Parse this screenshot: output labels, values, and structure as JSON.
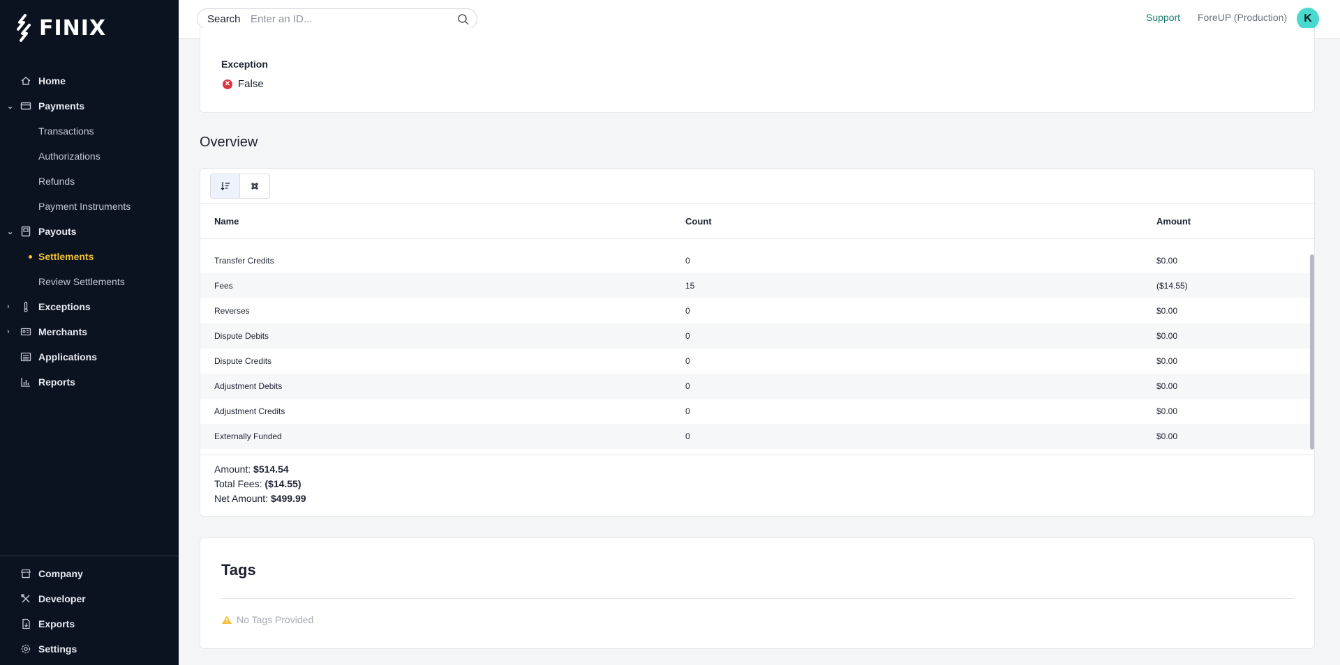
{
  "brand": {
    "name": "FINIX"
  },
  "sidebar": {
    "items": [
      {
        "label": "Home",
        "icon": "home-icon",
        "expandable": false
      },
      {
        "label": "Payments",
        "icon": "card-icon",
        "expandable": true,
        "expanded": true,
        "children": [
          "Transactions",
          "Authorizations",
          "Refunds",
          "Payment Instruments"
        ]
      },
      {
        "label": "Payouts",
        "icon": "ledger-icon",
        "expandable": true,
        "expanded": true,
        "children": [
          "Settlements",
          "Review Settlements"
        ]
      },
      {
        "label": "Exceptions",
        "icon": "thermometer-icon",
        "expandable": true,
        "expanded": false
      },
      {
        "label": "Merchants",
        "icon": "id-card-icon",
        "expandable": true,
        "expanded": false
      },
      {
        "label": "Applications",
        "icon": "list-icon",
        "expandable": false
      },
      {
        "label": "Reports",
        "icon": "bar-chart-icon",
        "expandable": false
      }
    ],
    "active": "Settlements",
    "active_color": "#f1c232",
    "bottom": [
      {
        "label": "Company",
        "icon": "store-icon"
      },
      {
        "label": "Developer",
        "icon": "tools-icon"
      },
      {
        "label": "Exports",
        "icon": "file-export-icon"
      },
      {
        "label": "Settings",
        "icon": "gear-icon"
      }
    ]
  },
  "header": {
    "search_label": "Search",
    "search_placeholder": "Enter an ID...",
    "support": "Support",
    "org": "ForeUP (Production)",
    "avatar_initial": "K",
    "avatar_color": "#4ad9cf"
  },
  "exception": {
    "label": "Exception",
    "value": "False",
    "status_color": "#d8363f"
  },
  "overview": {
    "title": "Overview",
    "columns": [
      "Name",
      "Count",
      "Amount"
    ],
    "rows": [
      {
        "name": "Transfer Credits",
        "count": "0",
        "amount": "$0.00"
      },
      {
        "name": "Fees",
        "count": "15",
        "amount": "($14.55)"
      },
      {
        "name": "Reverses",
        "count": "0",
        "amount": "$0.00"
      },
      {
        "name": "Dispute Debits",
        "count": "0",
        "amount": "$0.00"
      },
      {
        "name": "Dispute Credits",
        "count": "0",
        "amount": "$0.00"
      },
      {
        "name": "Adjustment Debits",
        "count": "0",
        "amount": "$0.00"
      },
      {
        "name": "Adjustment Credits",
        "count": "0",
        "amount": "$0.00"
      },
      {
        "name": "Externally Funded",
        "count": "0",
        "amount": "$0.00"
      }
    ],
    "summary": {
      "amount_label": "Amount:",
      "amount_value": "$514.54",
      "fees_label": "Total Fees:",
      "fees_value": "($14.55)",
      "net_label": "Net Amount:",
      "net_value": "$499.99"
    }
  },
  "tags": {
    "title": "Tags",
    "empty": "No Tags Provided",
    "warning_color": "#f1c232"
  }
}
